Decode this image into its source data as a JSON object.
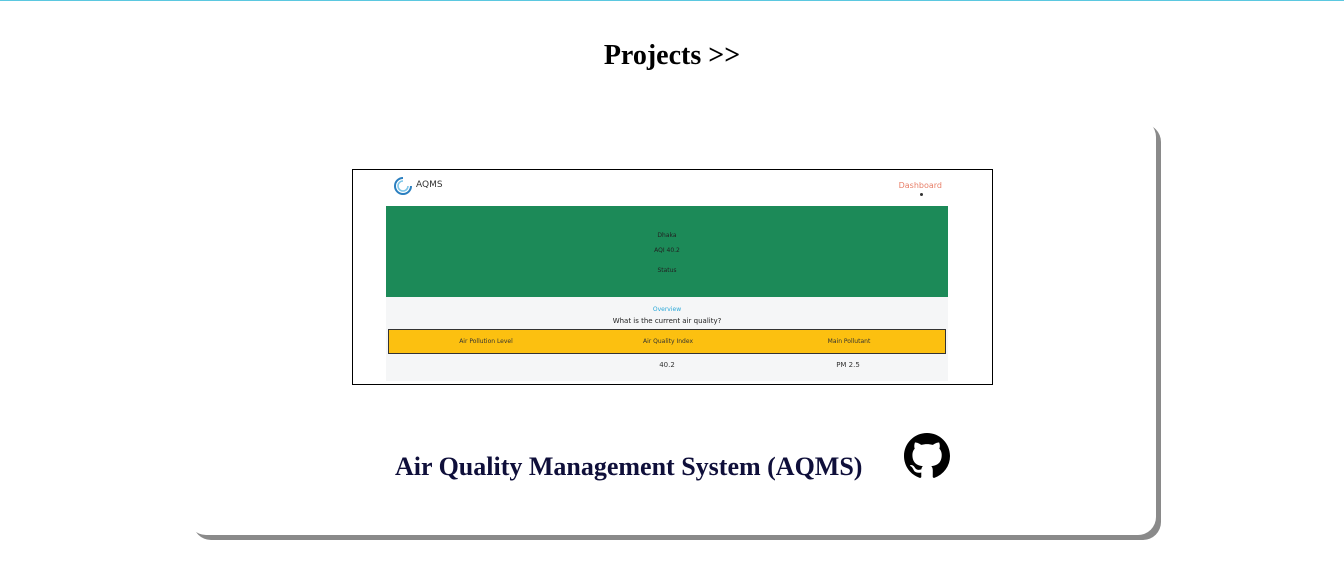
{
  "page": {
    "heading": "Projects >>"
  },
  "project": {
    "title": "Air Quality Management System (AQMS)",
    "link_icon": "github-icon",
    "preview": {
      "brand": "AQMS",
      "nav_link": "Dashboard",
      "hero_city": "Dhaka",
      "hero_aqi": "AQI 40.2",
      "hero_status": "Status",
      "overview": "Overview",
      "question": "What is the current air quality?",
      "table": {
        "headers": [
          "Air Pollution Level",
          "Air Quality Index",
          "Main Pollutant"
        ],
        "row": [
          "",
          "40.2",
          "PM 2.5"
        ]
      },
      "colors": {
        "hero": "#1c8a58",
        "table_header": "#fcc010",
        "nav_link": "#e8806a",
        "overview": "#2aa8d8"
      }
    }
  }
}
